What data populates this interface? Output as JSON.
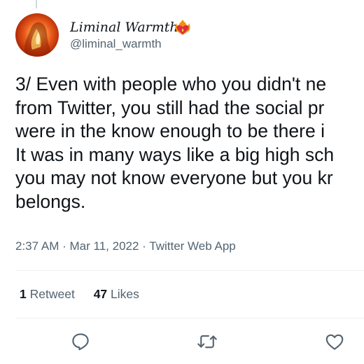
{
  "author": {
    "display_name": "Liminal Warmth",
    "handle": "@liminal_warmth",
    "name_emoji": "heart-on-fire-icon"
  },
  "tweet": {
    "lines": [
      "3/ Even with people who you didn't ne",
      "from Twitter, you still had the social pr",
      "were in the know enough to be there i",
      "It was in many ways like a big high sch",
      "you may not know everyone but you kr",
      "belongs."
    ]
  },
  "meta": {
    "time": "2:37 AM",
    "separator": "·",
    "date": "Mar 11, 2022",
    "source": "Twitter Web App"
  },
  "stats": {
    "retweets_count": "1",
    "retweets_label": "Retweet",
    "likes_count": "47",
    "likes_label": "Likes"
  },
  "actions": [
    "reply-icon",
    "retweet-icon",
    "like-icon"
  ],
  "colors": {
    "text": "#0f1419",
    "secondary": "#536471",
    "divider": "#eff3f4",
    "avatar_fire": "#ea5a1c"
  }
}
